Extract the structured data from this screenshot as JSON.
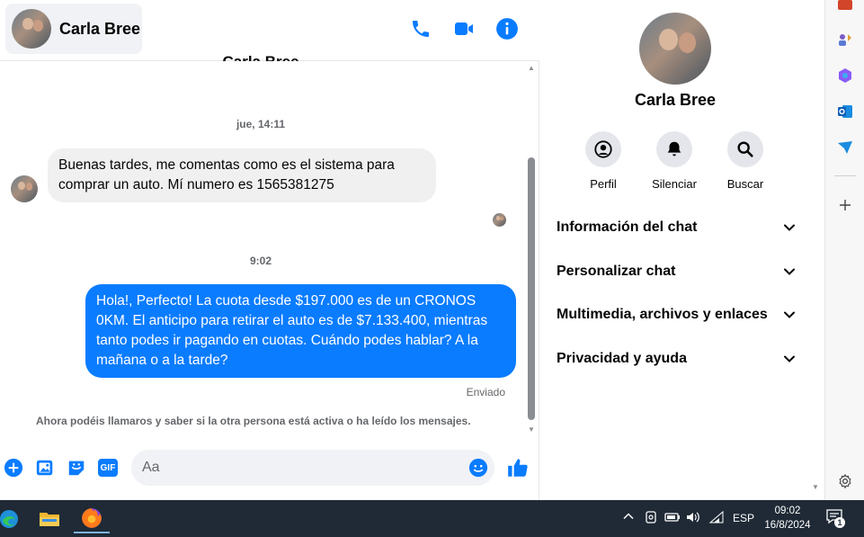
{
  "header": {
    "contact_name": "Carla Bree",
    "scrolled_title": "Carla Bree",
    "icons": [
      "phone-icon",
      "video-icon",
      "info-icon"
    ]
  },
  "messages": {
    "timestamp_1": "jue, 14:11",
    "incoming_text": "Buenas tardes, me comentas como es el sistema para comprar un auto. Mí numero es 1565381275",
    "timestamp_2": "9:02",
    "outgoing_text": "Hola!, Perfecto! La cuota desde $197.000 es de un CRONOS 0KM. El anticipo para retirar el auto es de $7.133.400, mientras tanto podes ir pagando en cuotas. Cuándo podes hablar? A la mañana o a la tarde?",
    "status": "Enviado",
    "notice": "Ahora podéis llamaros y saber si la otra persona está activa o ha leído los mensajes."
  },
  "composer": {
    "placeholder": "Aa",
    "value": "",
    "gif_label": "GIF"
  },
  "info_panel": {
    "name": "Carla Bree",
    "actions": [
      {
        "label": "Perfil",
        "icon": "profile-icon"
      },
      {
        "label": "Silenciar",
        "icon": "bell-icon"
      },
      {
        "label": "Buscar",
        "icon": "search-icon"
      }
    ],
    "sections": [
      {
        "label": "Información del chat"
      },
      {
        "label": "Personalizar chat"
      },
      {
        "label": "Multimedia, archivos y enlaces"
      },
      {
        "label": "Privacidad y ayuda"
      }
    ]
  },
  "taskbar": {
    "language": "ESP",
    "time": "09:02",
    "date": "16/8/2024",
    "notification_count": "1"
  },
  "colors": {
    "accent": "#0a7cff",
    "bubble_in": "#f0f0f0",
    "taskbar": "#1f2a36"
  }
}
